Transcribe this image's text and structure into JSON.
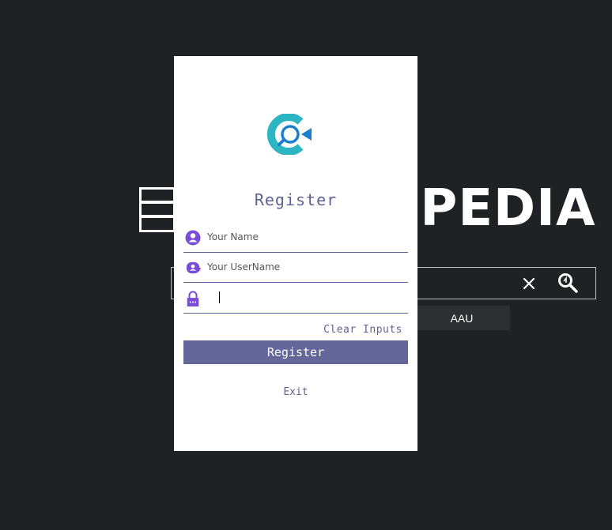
{
  "background": {
    "brand_text": "OPEDIA",
    "tag_label": "AAU"
  },
  "dialog": {
    "title": "Register",
    "fields": {
      "name_placeholder": "Your Name",
      "username_placeholder": "Your UserName",
      "password_value": ""
    },
    "clear_label": "Clear Inputs",
    "register_label": "Register",
    "exit_label": "Exit"
  },
  "icons": {
    "name": "user-circle-icon",
    "username": "user-tag-icon",
    "password": "lock-icon",
    "logo": "app-logo-icon"
  },
  "colors": {
    "background": "#202125",
    "dialog": "#ffffff",
    "accent": "#5e6391",
    "button": "#64679a",
    "icon": "#7a4dd8",
    "logo_teal": "#2cb5c2",
    "logo_blue": "#1b7fd0"
  }
}
